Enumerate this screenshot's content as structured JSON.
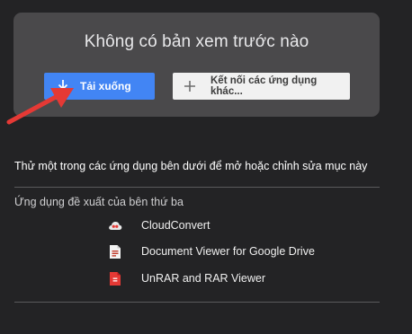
{
  "preview": {
    "title": "Không có bản xem trước nào",
    "download_label": "Tải xuống",
    "connect_label": "Kết nối các ứng dụng khác..."
  },
  "apps_section": {
    "heading": "Thử một trong các ứng dụng bên dưới để mở hoặc chỉnh sửa mục này",
    "suggested_label": "Ứng dụng đề xuất của bên thứ ba",
    "apps": [
      {
        "name": "CloudConvert",
        "icon": "cloudconvert-icon"
      },
      {
        "name": "Document Viewer for Google Drive",
        "icon": "document-viewer-icon"
      },
      {
        "name": "UnRAR and RAR Viewer",
        "icon": "unrar-icon"
      }
    ]
  },
  "colors": {
    "background": "#232325",
    "panel": "#4a494b",
    "download_button": "#4285f4",
    "annotation_arrow": "#e53935"
  }
}
